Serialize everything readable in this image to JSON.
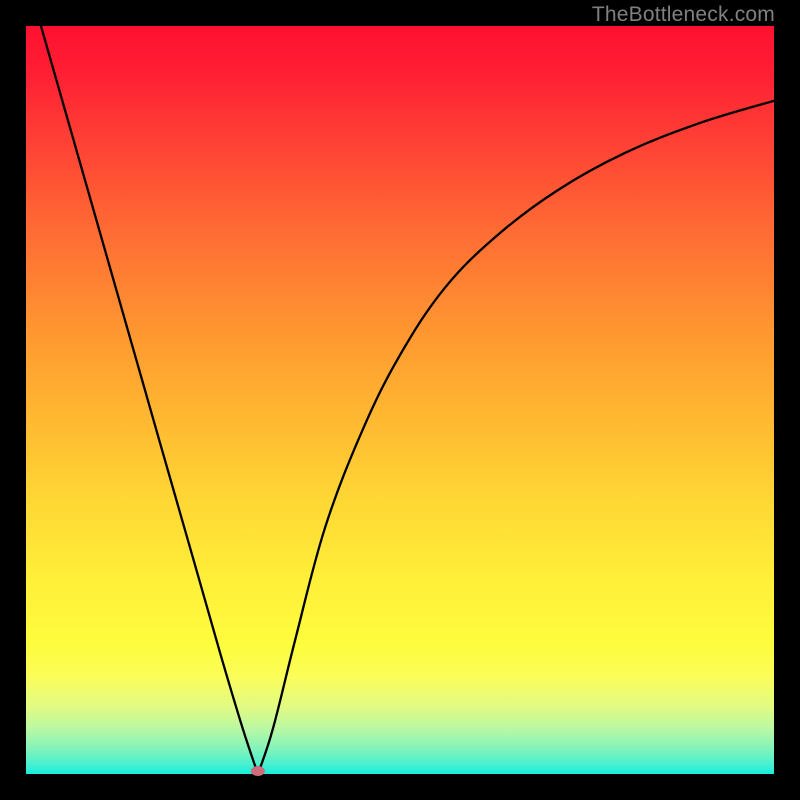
{
  "watermark": "TheBottleneck.com",
  "colors": {
    "frame": "#000000",
    "curve": "#000000",
    "dot": "#cb6d7a",
    "watermark": "#808080",
    "gradient_top": "#ff1030",
    "gradient_bottom": "#18eedd"
  },
  "chart_data": {
    "type": "line",
    "title": "",
    "xlabel": "",
    "ylabel": "",
    "xlim": [
      0,
      100
    ],
    "ylim": [
      0,
      100
    ],
    "annotations": [],
    "grid": false,
    "legend": null,
    "description": "Absolute-value/bottleneck curve: two branches descend toward zero at x≈31 then rise again; background encodes value as a red→yellow→green vertical gradient.",
    "minimum_point": {
      "x": 31,
      "y": 0
    },
    "series": [
      {
        "name": "left-branch",
        "x": [
          2,
          6,
          10,
          14,
          18,
          22,
          26,
          29,
          31
        ],
        "y": [
          100,
          86,
          72,
          58,
          44,
          30,
          16,
          6,
          0
        ]
      },
      {
        "name": "right-branch",
        "x": [
          31,
          33,
          36,
          40,
          45,
          50,
          56,
          63,
          71,
          80,
          90,
          100
        ],
        "y": [
          0,
          6,
          18,
          33,
          46,
          56,
          65,
          72,
          78,
          83,
          87,
          90
        ]
      }
    ]
  }
}
